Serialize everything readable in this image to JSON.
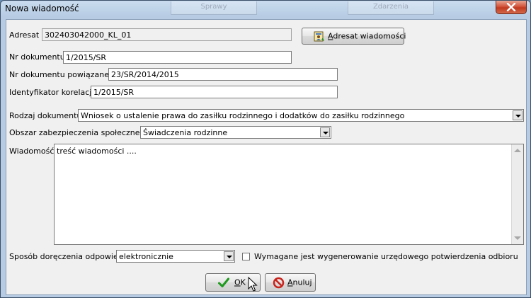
{
  "window": {
    "title": "Nowa wiadomość",
    "background_tabs": [
      "Sprawy",
      "Zdarzenia"
    ]
  },
  "form": {
    "adresat_label": "Adresat",
    "adresat_value": "302403042000_KL_01",
    "adresat_button_accel": "A",
    "adresat_button_rest": "dresat wiadomości",
    "nr_dokumentu_label": "Nr dokumentu",
    "nr_dokumentu_value": "1/2015/SR",
    "nr_powiazanego_label": "Nr dokumentu powiązanego",
    "nr_powiazanego_value": "23/SR/2014/2015",
    "identyfikator_label": "Identyfikator korelacji",
    "identyfikator_value": "1/2015/SR",
    "rodzaj_label": "Rodzaj dokumentu",
    "rodzaj_value": "Wniosek o ustalenie prawa do zasiłku rodzinnego i dodatków do zasiłku rodzinnego",
    "obszar_label": "Obszar zabezpieczenia społecznego",
    "obszar_value": "Świadczenia rodzinne",
    "wiadomosc_label": "Wiadomość",
    "wiadomosc_value": "treść wiadomości ....",
    "sposob_label": "Sposób doręczenia odpowiedzi",
    "sposob_value": "elektronicznie",
    "checkbox_label": "Wymagane jest wygenerowanie urzędowego potwierdzenia odbioru",
    "checkbox_checked": false
  },
  "buttons": {
    "ok_accel": "O",
    "ok_rest": "K",
    "cancel_accel": "A",
    "cancel_rest": "nuluj"
  },
  "colors": {
    "ok_check": "#1f9a1f",
    "cancel_icon": "#c8241c",
    "close_button": "#c9472d"
  },
  "icons": {
    "adresat_button": "address-book-icon",
    "ok": "checkmark-icon",
    "cancel": "no-entry-icon",
    "close": "close-icon",
    "cursor": "mouse-pointer-icon"
  }
}
